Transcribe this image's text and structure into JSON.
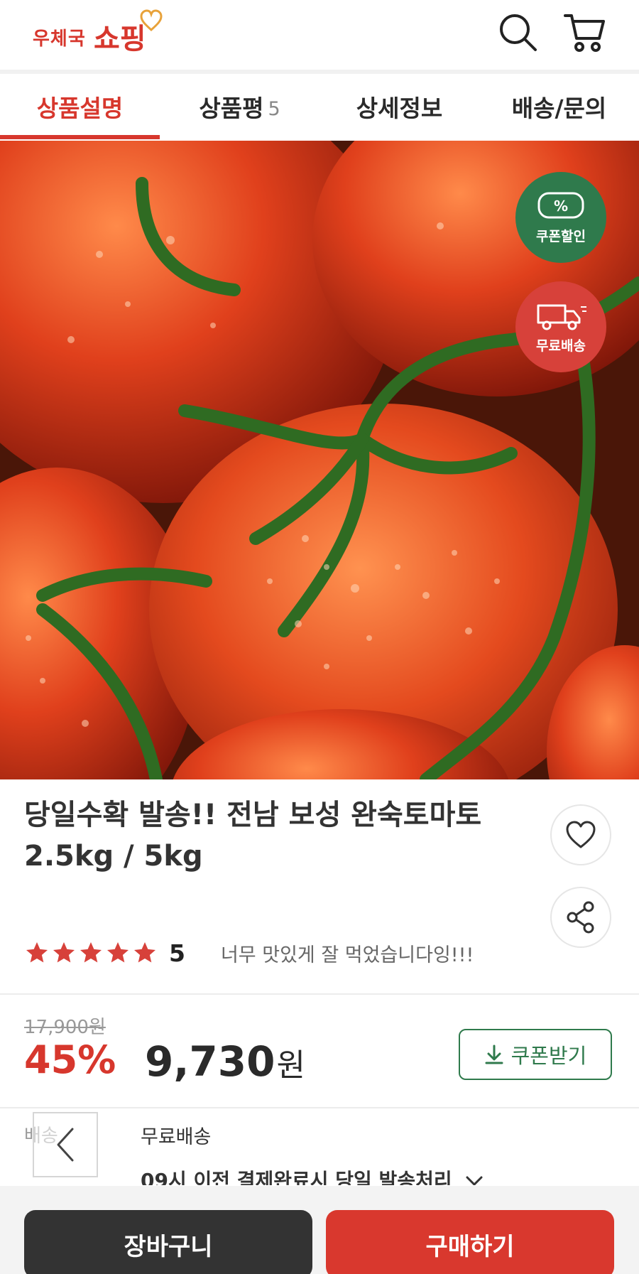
{
  "header": {
    "logo_small": "우체국",
    "logo_big": "쇼핑",
    "search_icon": "search-icon",
    "cart_icon": "cart-icon"
  },
  "tabs": [
    {
      "label": "상품설명",
      "active": true
    },
    {
      "label": "상품평",
      "count": "5"
    },
    {
      "label": "상세정보"
    },
    {
      "label": "배송/문의"
    }
  ],
  "badges": {
    "coupon": {
      "symbol": "%",
      "label": "쿠폰할인",
      "color": "#2f7a4c"
    },
    "free_shipping": {
      "label": "무료배송",
      "color": "#d7413a"
    }
  },
  "product": {
    "title": "당일수확 발송!! 전남 보성 완숙토마토 2.5kg / 5kg",
    "rating": {
      "stars": 5,
      "max": 5,
      "score": "5",
      "review": "너무 맛있게 잘 먹었습니다잉!!!"
    },
    "original_price": "17,900원",
    "discount": "45%",
    "price": "9,730",
    "price_unit": "원",
    "coupon_button": "쿠폰받기"
  },
  "shipping": {
    "label": "배송",
    "value": "무료배송",
    "note": "09시 이전 결제완료시 당일 발송처리"
  },
  "bottom": {
    "cart_button": "장바구니",
    "buy_button": "구매하기"
  },
  "colors": {
    "brand_red": "#d7372d",
    "coupon_green": "#2f7a4c",
    "dark_button": "#333333"
  }
}
